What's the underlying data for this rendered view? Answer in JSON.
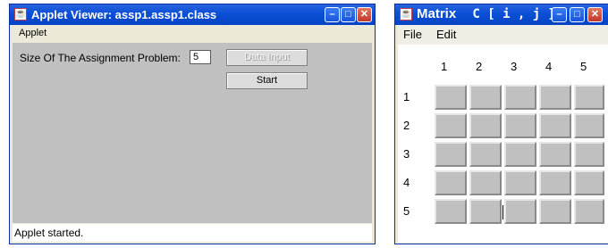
{
  "applet_window": {
    "title": "Applet Viewer: assp1.assp1.class",
    "menu": [
      "Applet"
    ],
    "size_label": "Size Of The Assignment Problem:",
    "size_value": "5",
    "data_input_label": "Data Input",
    "start_label": "Start",
    "status": "Applet started."
  },
  "matrix_window": {
    "title_prefix": "Matrix",
    "title_suffix": "C [ i , j ]",
    "menu": [
      "File",
      "Edit"
    ],
    "column_headers": [
      "1",
      "2",
      "3",
      "4",
      "5"
    ],
    "row_headers": [
      "1",
      "2",
      "3",
      "4",
      "5"
    ],
    "cells": [
      [
        "",
        "",
        "",
        "",
        ""
      ],
      [
        "",
        "",
        "",
        "",
        ""
      ],
      [
        "",
        "",
        "",
        "",
        ""
      ],
      [
        "",
        "",
        "",
        "",
        ""
      ],
      [
        "",
        "",
        "",
        "",
        ""
      ]
    ]
  },
  "colors": {
    "titlebar": "#0a4fd6",
    "panel": "#c0c0c0",
    "close_button": "#c0392b"
  }
}
